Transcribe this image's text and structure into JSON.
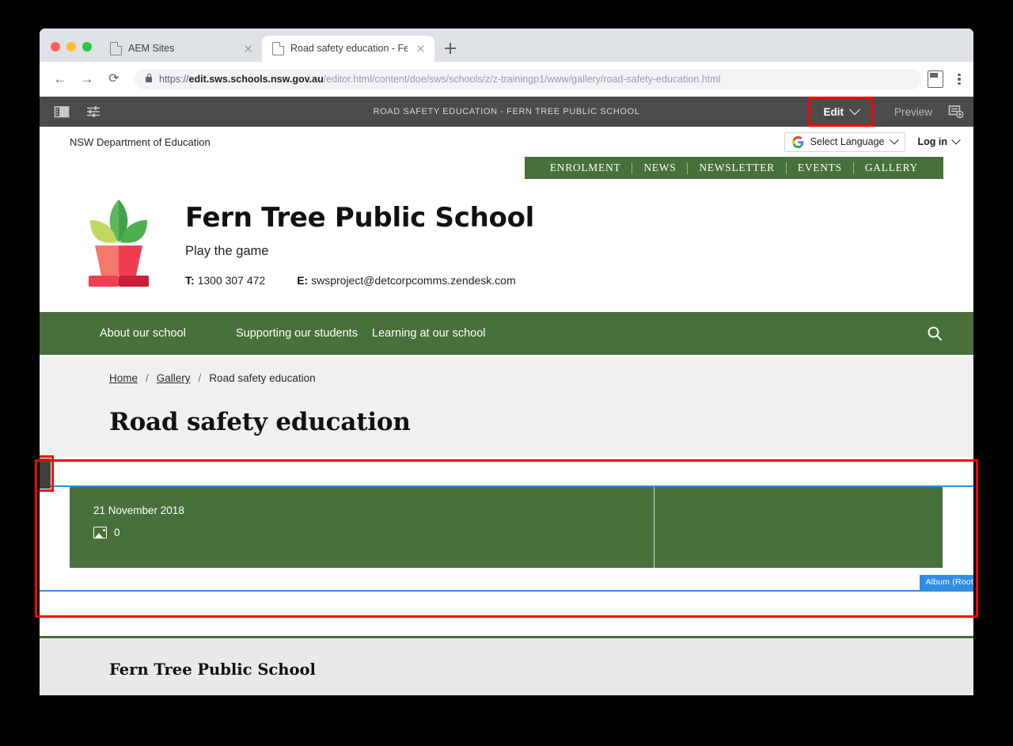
{
  "browser": {
    "tabs": [
      {
        "title": "AEM Sites",
        "active": false
      },
      {
        "title": "Road safety education - Fern T",
        "active": true
      }
    ],
    "new_tab_label": "+",
    "back_glyph": "←",
    "forward_glyph": "→",
    "reload_glyph": "⟳",
    "url": {
      "scheme": "https://",
      "host": "edit.sws.schools.nsw.gov.au",
      "path": "/editor.html/content/doe/sws/schools/z/z-trainingp1/www/gallery/road-safety-education.html"
    }
  },
  "aem_toolbar": {
    "page_title": "ROAD SAFETY EDUCATION - FERN TREE PUBLIC SCHOOL",
    "edit_label": "Edit",
    "preview_label": "Preview",
    "highlight_color": "#ff0000",
    "bar_color": "#4b4b4b"
  },
  "doe_bar": {
    "department": "NSW Department of Education",
    "language_label": "Select Language",
    "login_label": "Log in"
  },
  "utility_nav": {
    "items": [
      "ENROLMENT",
      "NEWS",
      "NEWSLETTER",
      "EVENTS",
      "GALLERY"
    ]
  },
  "school": {
    "name": "Fern Tree Public School",
    "tagline": "Play the game",
    "phone_label": "T:",
    "phone": "1300 307 472",
    "email_label": "E:",
    "email": "swsproject@detcorpcomms.zendesk.com"
  },
  "main_nav": {
    "items": [
      "About our school",
      "Supporting our students",
      "Learning at our school"
    ]
  },
  "breadcrumb": {
    "items": [
      "Home",
      "Gallery",
      "Road safety education"
    ],
    "separator": "/"
  },
  "page": {
    "title": "Road safety education"
  },
  "album_component": {
    "badge": "Album (Root",
    "tile_date": "21 November 2018",
    "image_count": "0",
    "tile_color": "#48703a",
    "outline_color": "#2f8de4"
  },
  "footer": {
    "title": "Fern Tree Public School",
    "accent_color": "#48703a"
  },
  "theme": {
    "green": "#48703a",
    "blue": "#2f8de4",
    "red": "#ff0000"
  }
}
